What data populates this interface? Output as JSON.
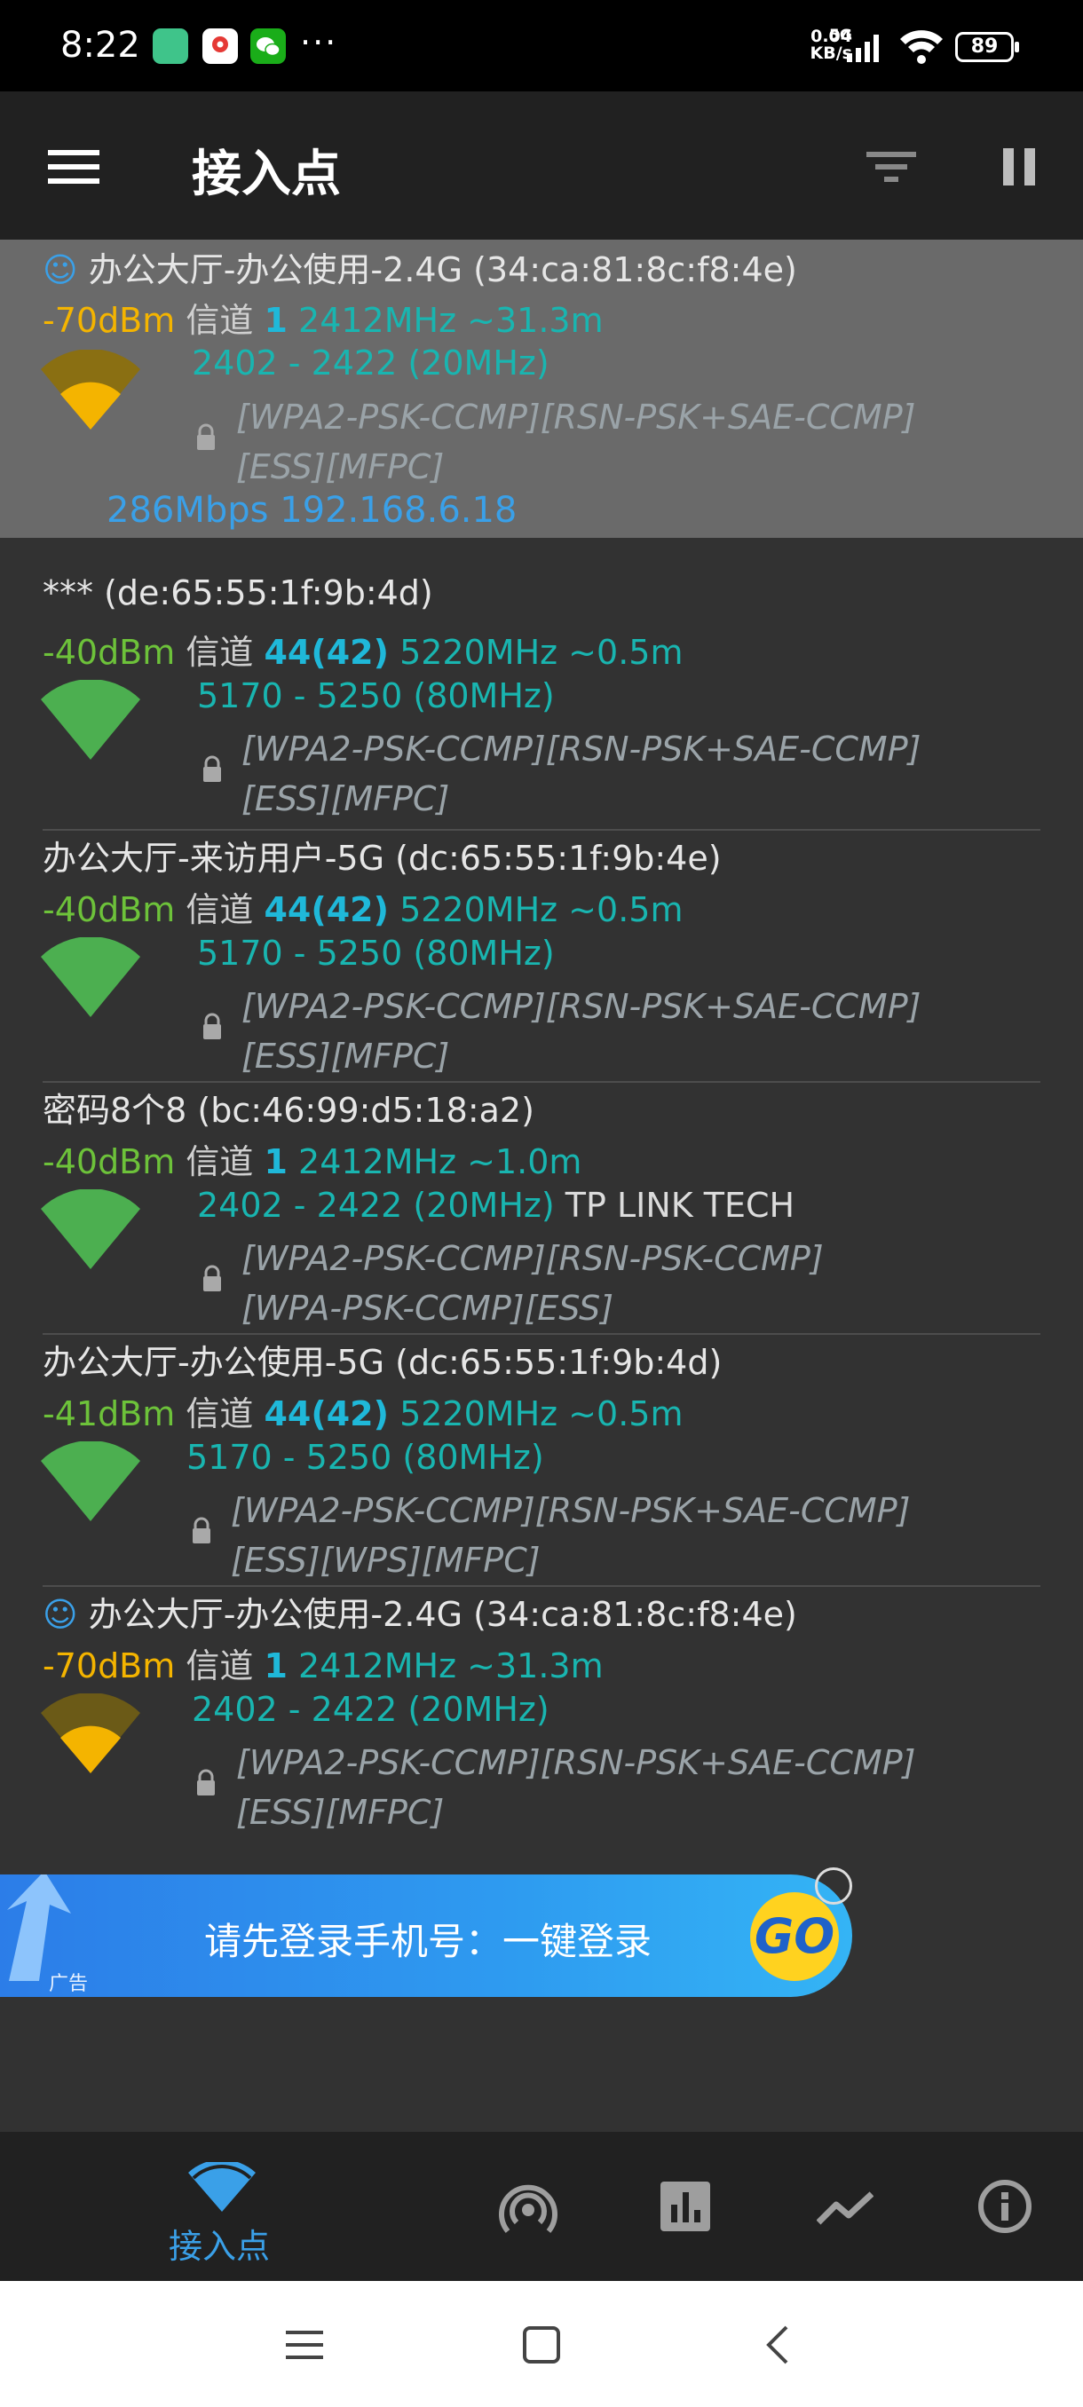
{
  "status_bar": {
    "time": "8:22",
    "more": "···",
    "net_speed_value": "0.04",
    "net_speed_unit": "KB/s",
    "net_type": "5G",
    "battery": "89"
  },
  "app_bar": {
    "title": "接入点",
    "menu_icon": "hamburger-menu-icon",
    "filter_icon": "filter-icon",
    "pause_icon": "pause-icon"
  },
  "access_points": [
    {
      "ssid": "办公大厅-办公使用-2.4G (34:ca:81:8c:f8:4e)",
      "connected": true,
      "rssi": "-70dBm",
      "channel_label": "信道",
      "channel": "1",
      "freq": "2412MHz ~31.3m",
      "range": "2402 - 2422 (20MHz)",
      "vendor": "",
      "security_1": "[WPA2-PSK-CCMP][RSN-PSK+SAE-CCMP]",
      "security_2": "[ESS][MFPC]",
      "link": "286Mbps 192.168.6.18"
    },
    {
      "ssid": "*** (de:65:55:1f:9b:4d)",
      "rssi": "-40dBm",
      "channel_label": "信道",
      "channel": "44(42)",
      "freq": "5220MHz ~0.5m",
      "range": "5170 - 5250 (80MHz)",
      "vendor": "",
      "security_1": "[WPA2-PSK-CCMP][RSN-PSK+SAE-CCMP]",
      "security_2": "[ESS][MFPC]"
    },
    {
      "ssid": "办公大厅-来访用户-5G (dc:65:55:1f:9b:4e)",
      "rssi": "-40dBm",
      "channel_label": "信道",
      "channel": "44(42)",
      "freq": "5220MHz ~0.5m",
      "range": "5170 - 5250 (80MHz)",
      "vendor": "",
      "security_1": "[WPA2-PSK-CCMP][RSN-PSK+SAE-CCMP]",
      "security_2": "[ESS][MFPC]"
    },
    {
      "ssid": "密码8个8 (bc:46:99:d5:18:a2)",
      "rssi": "-40dBm",
      "channel_label": "信道",
      "channel": "1",
      "freq": "2412MHz ~1.0m",
      "range": "2402 - 2422 (20MHz)",
      "vendor": "TP LINK TECH",
      "security_1": "[WPA2-PSK-CCMP][RSN-PSK-CCMP]",
      "security_2": "[WPA-PSK-CCMP][ESS]"
    },
    {
      "ssid": "办公大厅-办公使用-5G (dc:65:55:1f:9b:4d)",
      "rssi": "-41dBm",
      "channel_label": "信道",
      "channel": "44(42)",
      "freq": "5220MHz ~0.5m",
      "range": "5170 - 5250 (80MHz)",
      "vendor": "",
      "security_1": "[WPA2-PSK-CCMP][RSN-PSK+SAE-CCMP]",
      "security_2": "[ESS][WPS][MFPC]"
    },
    {
      "ssid": "办公大厅-办公使用-2.4G (34:ca:81:8c:f8:4e)",
      "rssi": "-70dBm",
      "channel_label": "信道",
      "channel": "1",
      "freq": "2412MHz ~31.3m",
      "range": "2402 - 2422 (20MHz)",
      "vendor": "",
      "security_1": "[WPA2-PSK-CCMP][RSN-PSK+SAE-CCMP]",
      "security_2": "[ESS][MFPC]"
    }
  ],
  "ad": {
    "text": "请先登录手机号：一键登录",
    "tag": "广告",
    "go": "GO"
  },
  "bottom_nav": {
    "active_label": "接入点",
    "items": [
      "wifi-ap-icon",
      "hotspot-icon",
      "bar-chart-icon",
      "trend-icon",
      "info-icon"
    ]
  },
  "colors": {
    "background": "#323232",
    "appbar": "#212121",
    "accent": "#3aa0e8",
    "strong": "#6dc23a",
    "weak": "#f4b400",
    "channel": "#1fb8d9"
  }
}
